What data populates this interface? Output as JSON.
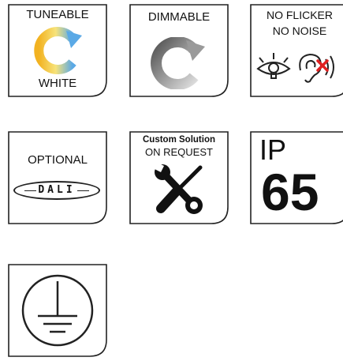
{
  "tiles": {
    "tuneable": {
      "top": "TUNEABLE",
      "bottom": "WHITE",
      "icon": "tuneable-white-refresh-icon"
    },
    "dimmable": {
      "label": "DIMMABLE",
      "icon": "dimmable-refresh-icon"
    },
    "noflicker": {
      "line1": "NO FLICKER",
      "line2": "NO NOISE",
      "icon": "eye-and-muted-ear-icon"
    },
    "optional": {
      "label": "OPTIONAL",
      "badge": "DALI"
    },
    "custom": {
      "line1": "Custom Solution",
      "line2": "ON REQUEST",
      "icon": "wrench-screwdriver-icon"
    },
    "ip": {
      "prefix": "IP",
      "rating": "65"
    },
    "ground": {
      "icon": "protective-earth-icon"
    }
  },
  "colors": {
    "border": "#222222",
    "tuneable_warm": "#f2b221",
    "tuneable_cool": "#5aa9e6",
    "dim_dark": "#555555",
    "dim_light": "#d9d9d9",
    "muted_red": "#e02020"
  }
}
